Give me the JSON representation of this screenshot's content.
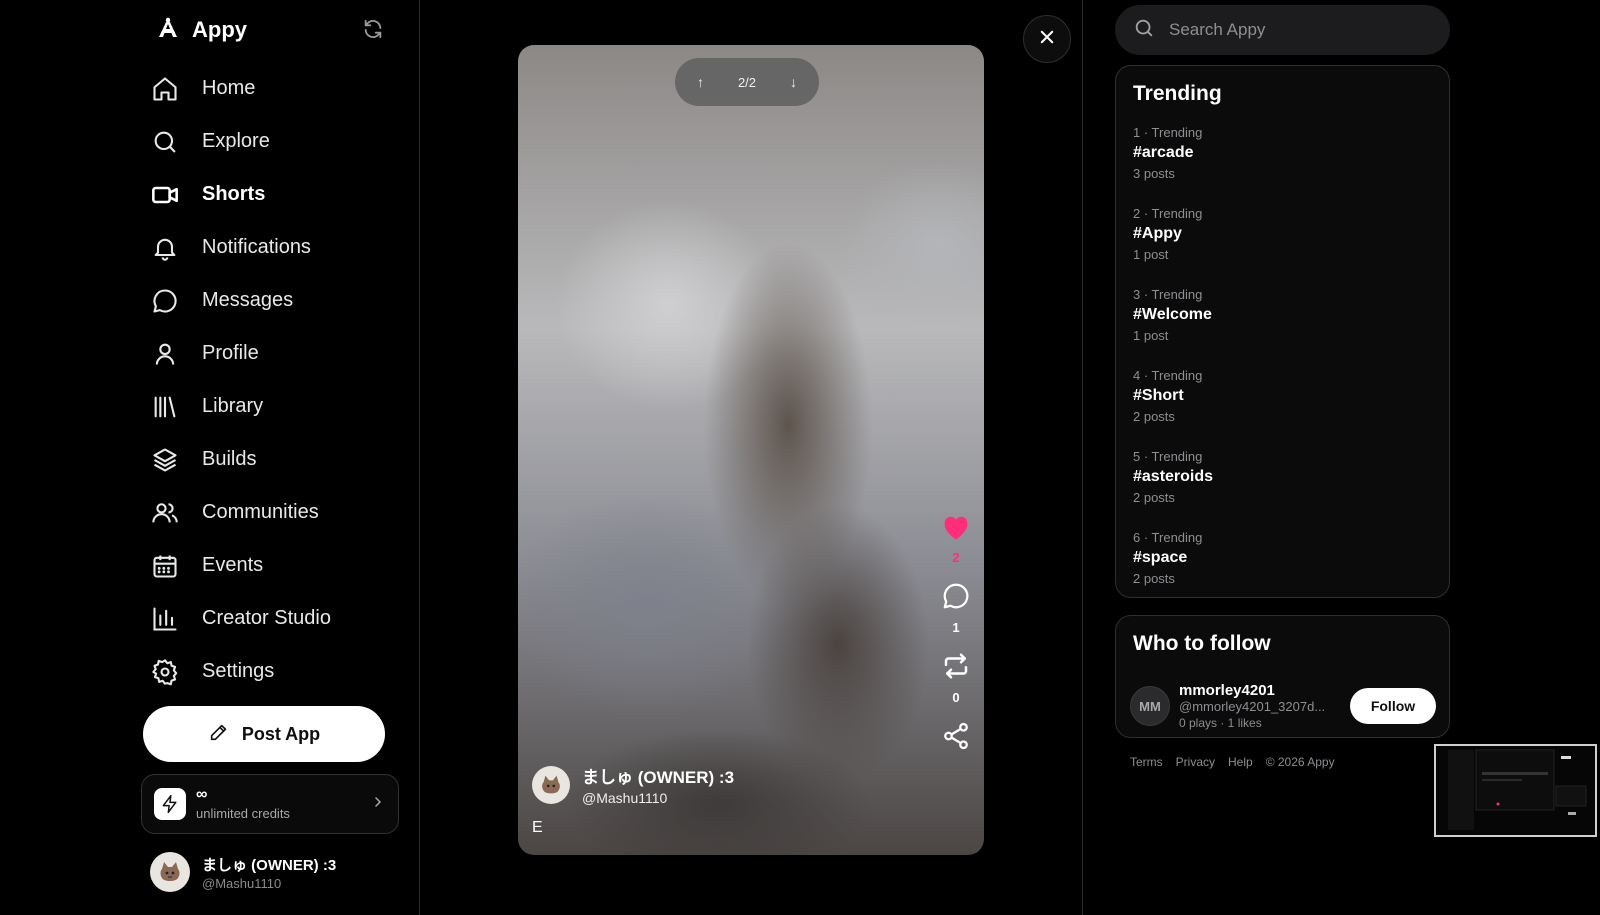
{
  "app": {
    "name": "Appy"
  },
  "sidebar": {
    "items": [
      {
        "label": "Home",
        "icon": "home-icon",
        "active": false
      },
      {
        "label": "Explore",
        "icon": "search-icon",
        "active": false
      },
      {
        "label": "Shorts",
        "icon": "video-camera-icon",
        "active": true
      },
      {
        "label": "Notifications",
        "icon": "bell-icon",
        "active": false
      },
      {
        "label": "Messages",
        "icon": "message-bubble-icon",
        "active": false
      },
      {
        "label": "Profile",
        "icon": "user-icon",
        "active": false
      },
      {
        "label": "Library",
        "icon": "library-icon",
        "active": false
      },
      {
        "label": "Builds",
        "icon": "layers-icon",
        "active": false
      },
      {
        "label": "Communities",
        "icon": "users-icon",
        "active": false
      },
      {
        "label": "Events",
        "icon": "calendar-icon",
        "active": false
      },
      {
        "label": "Creator Studio",
        "icon": "bar-chart-icon",
        "active": false
      },
      {
        "label": "Settings",
        "icon": "gear-icon",
        "active": false
      }
    ],
    "post_button": "Post App",
    "credits": {
      "value": "∞",
      "label": "unlimited credits"
    },
    "account": {
      "name": "ましゅ (OWNER) :3",
      "handle": "@Mashu1110"
    }
  },
  "short": {
    "pager": "2/2",
    "likes": "2",
    "comments": "1",
    "reposts": "0",
    "author_name": "ましゅ (OWNER) :3",
    "author_handle": "@Mashu1110",
    "caption": "E"
  },
  "search": {
    "placeholder": "Search Appy"
  },
  "trending": {
    "title": "Trending",
    "items": [
      {
        "meta": "1 · Trending",
        "tag": "#arcade",
        "posts": "3 posts"
      },
      {
        "meta": "2 · Trending",
        "tag": "#Appy",
        "posts": "1 post"
      },
      {
        "meta": "3 · Trending",
        "tag": "#Welcome",
        "posts": "1 post"
      },
      {
        "meta": "4 · Trending",
        "tag": "#Short",
        "posts": "2 posts"
      },
      {
        "meta": "5 · Trending",
        "tag": "#asteroids",
        "posts": "2 posts"
      },
      {
        "meta": "6 · Trending",
        "tag": "#space",
        "posts": "2 posts"
      }
    ]
  },
  "who_to_follow": {
    "title": "Who to follow",
    "user": {
      "initials": "MM",
      "name": "mmorley4201",
      "handle": "@mmorley4201_3207d...",
      "stats": "0 plays · 1 likes"
    },
    "follow_label": "Follow"
  },
  "footer": {
    "terms": "Terms",
    "privacy": "Privacy",
    "help": "Help",
    "copyright": "© 2026 Appy"
  },
  "colors": {
    "accent_like": "#ff2d7a",
    "background": "#000000",
    "button": "#ffffff"
  }
}
